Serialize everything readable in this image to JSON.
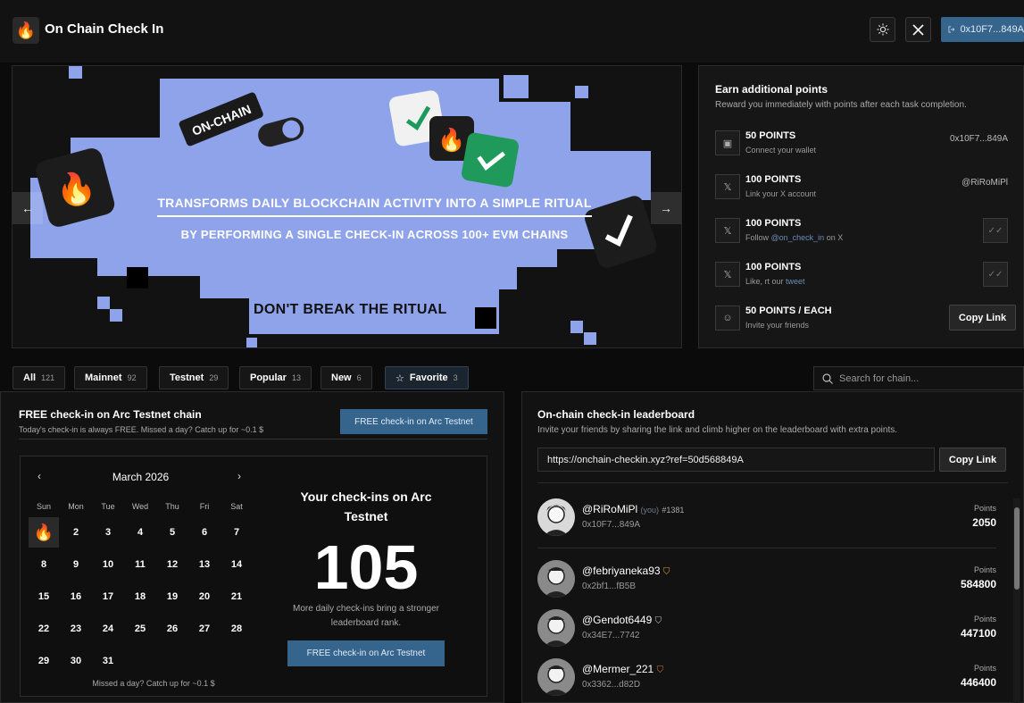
{
  "app": {
    "title": "On Chain Check In",
    "logo_icon": "🔥",
    "wallet_label": "0x10F7...849A"
  },
  "banner": {
    "badge": "ON-CHAIN",
    "line1": "TRANSFORMS DAILY BLOCKCHAIN ACTIVITY INTO A SIMPLE RITUAL",
    "line2": "BY PERFORMING A SINGLE CHECK-IN ACROSS 100+ EVM CHAINS",
    "line3": "DON'T BREAK THE RITUAL",
    "bg_color": "#8fa3ea"
  },
  "earn": {
    "title": "Earn additional points",
    "subtitle": "Reward you immediately with points after each task completion.",
    "tasks": [
      {
        "points": "50 POINTS",
        "desc": "Connect your wallet",
        "right": "0x10F7...849A",
        "icon": "wallet-icon"
      },
      {
        "points": "100 POINTS",
        "desc": "Link your X account",
        "right": "@RiRoMiPl",
        "icon": "x-icon"
      },
      {
        "points": "100 POINTS",
        "desc_pre": "Follow ",
        "desc_link": "@on_check_in",
        "desc_post": " on X",
        "icon": "x-icon"
      },
      {
        "points": "100 POINTS",
        "desc_pre": "Like, rt our ",
        "desc_link": "tweet",
        "icon": "x-icon"
      },
      {
        "points": "50 POINTS / EACH",
        "desc": "Invite your friends",
        "button": "Copy Link",
        "icon": "users-icon"
      }
    ]
  },
  "tabs": [
    {
      "label": "All",
      "count": "121"
    },
    {
      "label": "Mainnet",
      "count": "92"
    },
    {
      "label": "Testnet",
      "count": "29"
    },
    {
      "label": "Popular",
      "count": "13"
    },
    {
      "label": "New",
      "count": "6"
    },
    {
      "label": "Favorite",
      "count": "3"
    }
  ],
  "search": {
    "placeholder": "Search for chain..."
  },
  "checkin": {
    "title": "FREE check-in on Arc Testnet chain",
    "subtitle": "Today's check-in is always FREE. Missed a day? Catch up for ~0.1 $",
    "button": "FREE check-in on Arc Testnet",
    "calendar": {
      "month": "March 2026",
      "weekdays": [
        "Sun",
        "Mon",
        "Tue",
        "Wed",
        "Thu",
        "Fri",
        "Sat"
      ],
      "days": [
        "🔥",
        "2",
        "3",
        "4",
        "5",
        "6",
        "7",
        "8",
        "9",
        "10",
        "11",
        "12",
        "13",
        "14",
        "15",
        "16",
        "17",
        "18",
        "19",
        "20",
        "21",
        "22",
        "23",
        "24",
        "25",
        "26",
        "27",
        "28",
        "29",
        "30",
        "31"
      ],
      "note": "Missed a day? Catch up for ~0.1 $"
    },
    "your_checkins_title": "Your check-ins on Arc Testnet",
    "count": "105",
    "note": "More daily check-ins bring a stronger leaderboard rank.",
    "button2": "FREE check-in on Arc Testnet"
  },
  "leaderboard": {
    "title": "On-chain check-in leaderboard",
    "subtitle": "Invite your friends by sharing the link and climb higher on the leaderboard with extra points.",
    "link": "https://onchain-checkin.xyz?ref=50d568849A",
    "copy_button": "Copy Link",
    "points_label": "Points",
    "rows": [
      {
        "name": "@RiRoMiPl",
        "you": "(you)",
        "rank": "#1381",
        "addr": "0x10F7...849A",
        "points": "2050"
      },
      {
        "name": "@febriyaneka93",
        "badge": "gold",
        "addr": "0x2bf1...fB5B",
        "points": "584800"
      },
      {
        "name": "@Gendot6449",
        "badge": "silver",
        "addr": "0x34E7...7742",
        "points": "447100"
      },
      {
        "name": "@Mermer_221",
        "badge": "bronze",
        "addr": "0x3362...d82D",
        "points": "446400"
      }
    ]
  }
}
